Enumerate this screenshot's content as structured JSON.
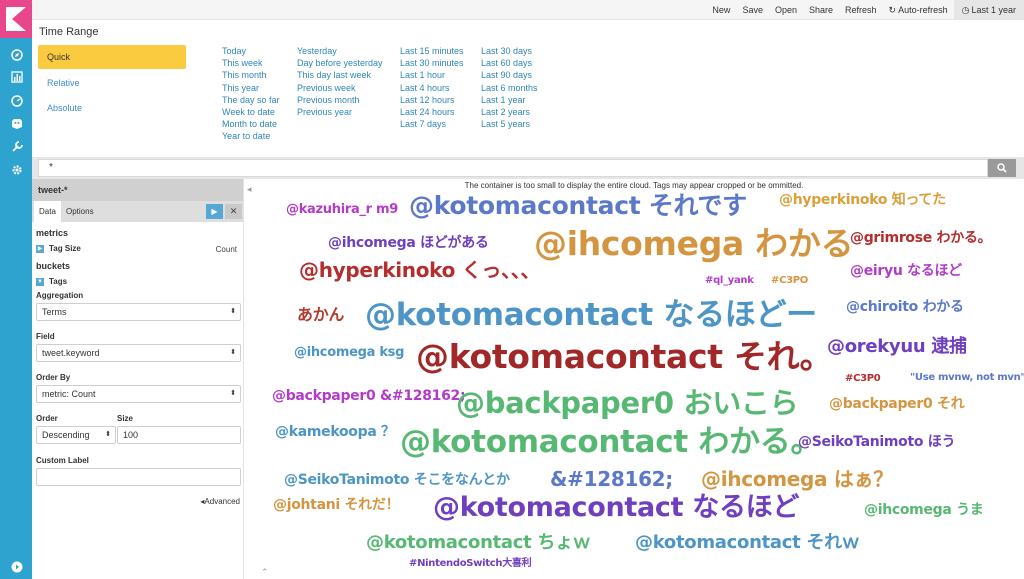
{
  "topbar": {
    "menu": [
      "New",
      "Save",
      "Open",
      "Share",
      "Refresh",
      "Auto-refresh",
      "Last 1 year"
    ]
  },
  "timepicker": {
    "title": "Time Range",
    "tabs": [
      "Quick",
      "Relative",
      "Absolute"
    ],
    "columns": [
      [
        "Today",
        "This week",
        "This month",
        "This year",
        "The day so far",
        "Week to date",
        "Month to date",
        "Year to date"
      ],
      [
        "Yesterday",
        "Day before yesterday",
        "This day last week",
        "Previous week",
        "Previous month",
        "Previous year"
      ],
      [
        "Last 15 minutes",
        "Last 30 minutes",
        "Last 1 hour",
        "Last 4 hours",
        "Last 12 hours",
        "Last 24 hours",
        "Last 7 days"
      ],
      [
        "Last 30 days",
        "Last 60 days",
        "Last 90 days",
        "Last 6 months",
        "Last 1 year",
        "Last 2 years",
        "Last 5 years"
      ]
    ]
  },
  "query": {
    "value": "*"
  },
  "sidebar": {
    "index": "tweet-*",
    "tabs": [
      "Data",
      "Options"
    ],
    "metrics_title": "metrics",
    "metric_label": "Tag Size",
    "metric_value": "Count",
    "buckets_title": "buckets",
    "bucket_label": "Tags",
    "aggregation_label": "Aggregation",
    "aggregation_value": "Terms",
    "field_label": "Field",
    "field_value": "tweet.keyword",
    "orderby_label": "Order By",
    "orderby_value": "metric: Count",
    "order_label": "Order",
    "order_value": "Descending",
    "size_label": "Size",
    "size_value": "100",
    "custom_label": "Custom Label",
    "advanced": "Advanced"
  },
  "cloud": {
    "warning": "The container is too small to display the entire cloud. Tags may appear cropped or be ommitted.",
    "tags": [
      {
        "text": "@kazuhira_r m9",
        "color": "#b23cc8"
      },
      {
        "text": "@kotomacontact それです",
        "color": "#5b78c9"
      },
      {
        "text": "@hyperkinoko 知ってた",
        "color": "#d9a03c"
      },
      {
        "text": "@ihcomega ほどがある",
        "color": "#6f3fbf"
      },
      {
        "text": "@ihcomega わかる",
        "color": "#d49541"
      },
      {
        "text": "@grimrose わかる。",
        "color": "#b42e2e"
      },
      {
        "text": "@hyperkinoko くっ、、、",
        "color": "#b42e2e"
      },
      {
        "text": "#ql_yank",
        "color": "#b23cc8"
      },
      {
        "text": "#C3PO",
        "color": "#d49541"
      },
      {
        "text": "@eiryu なるほど",
        "color": "#b23cc8"
      },
      {
        "text": "あかん",
        "color": "#b23c2e"
      },
      {
        "text": "@kotomacontact なるほどー",
        "color": "#4d95c6"
      },
      {
        "text": "@chiroito わかる",
        "color": "#5b78c9"
      },
      {
        "text": "@ihcomega ksg",
        "color": "#4d95c6"
      },
      {
        "text": "@kotomacontact それ。",
        "color": "#a02828"
      },
      {
        "text": "@orekyuu 逮捕",
        "color": "#6f3fbf"
      },
      {
        "text": "#C3P0",
        "color": "#b42e2e"
      },
      {
        "text": "\"Use mvnw, not mvn\"",
        "color": "#5b78c9"
      },
      {
        "text": "@backpaper0 &#128162;",
        "color": "#b23cc8"
      },
      {
        "text": "@backpaper0 おいこら",
        "color": "#57b873"
      },
      {
        "text": "@backpaper0 それ",
        "color": "#d49541"
      },
      {
        "text": "@kamekoopa ？",
        "color": "#4d95c6"
      },
      {
        "text": "@kotomacontact わかる。",
        "color": "#57b873"
      },
      {
        "text": "@SeikoTanimoto ほう",
        "color": "#6f3fbf"
      },
      {
        "text": "@SeikoTanimoto そこをなんとか",
        "color": "#4d95c6"
      },
      {
        "text": "&#128162;",
        "color": "#5b78c9"
      },
      {
        "text": "@ihcomega はぁ？",
        "color": "#d49541"
      },
      {
        "text": "@johtani それだ！",
        "color": "#d49541"
      },
      {
        "text": "@kotomacontact なるほど",
        "color": "#6f3fbf"
      },
      {
        "text": "@ihcomega うま",
        "color": "#57b873"
      },
      {
        "text": "@kotomacontact ちょｗ",
        "color": "#57b873"
      },
      {
        "text": "@kotomacontact それｗ",
        "color": "#4d95c6"
      },
      {
        "text": "#NintendoSwitch大喜利",
        "color": "#6f3fbf"
      }
    ]
  },
  "colors": {
    "nav": "#2ea3cf",
    "logo": "#e8478b",
    "quick_tab": "#fbcb3f",
    "link": "#2f87b7"
  }
}
